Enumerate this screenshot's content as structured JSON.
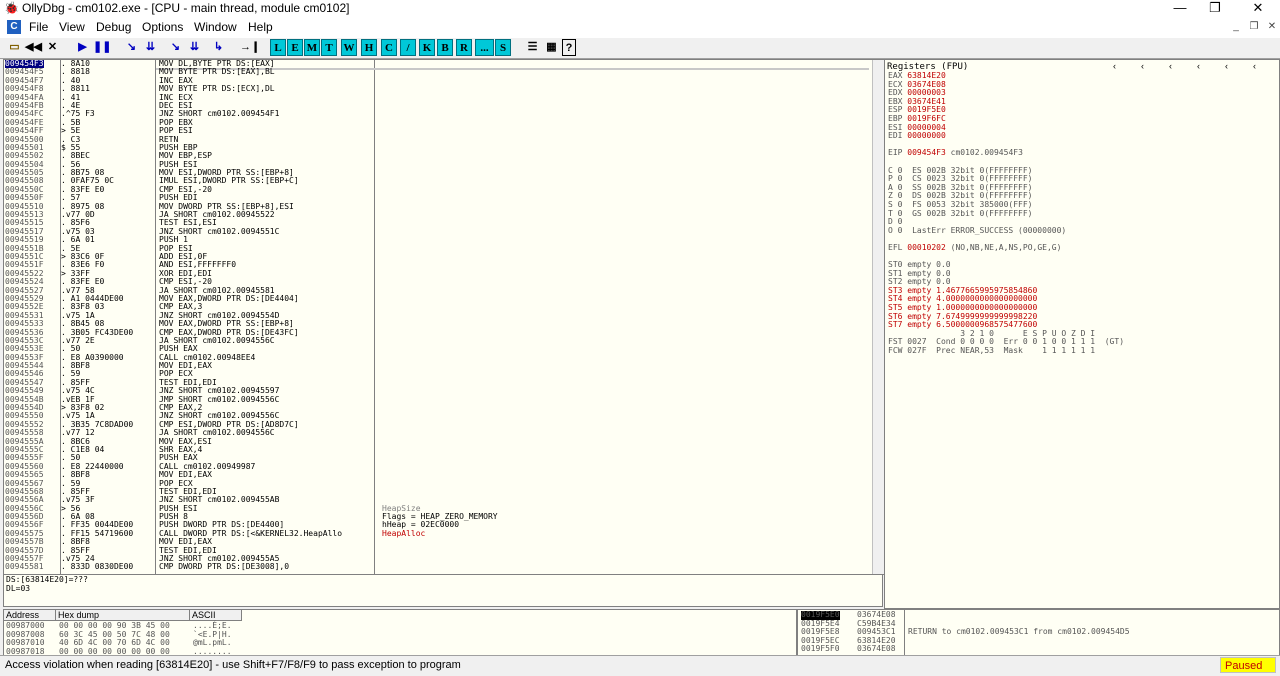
{
  "window": {
    "title": "OllyDbg - cm0102.exe - [CPU - main thread, module cm0102]",
    "minimize": "—",
    "restore": "❐",
    "close": "✕"
  },
  "menu": [
    "File",
    "View",
    "Debug",
    "Options",
    "Window",
    "Help"
  ],
  "toolbar": {
    "icon_buttons": [
      "open-icon",
      "rewind-icon",
      "close-icon",
      "run-icon",
      "pause-icon",
      "step-into-icon",
      "step-over-icon",
      "trace-into-icon",
      "trace-over-icon",
      "execute-till-return-icon",
      "goto-icon"
    ],
    "window_buttons": [
      "L",
      "E",
      "M",
      "T",
      "W",
      "H",
      "C",
      "/",
      "K",
      "B",
      "R",
      "...",
      "S"
    ],
    "extra": [
      "list-icon",
      "grid-icon",
      "help-icon"
    ]
  },
  "disasm": [
    {
      "addr": "009454F3",
      "hex": ". 8A10",
      "cmd": "MOV DL,BYTE PTR DS:[EAX]",
      "sel": true
    },
    {
      "addr": "009454F5",
      "hex": ". 8818",
      "cmd": "MOV BYTE PTR DS:[EAX],BL"
    },
    {
      "addr": "009454F7",
      "hex": ". 40",
      "cmd": "INC EAX"
    },
    {
      "addr": "009454F8",
      "hex": ". 8811",
      "cmd": "MOV BYTE PTR DS:[ECX],DL"
    },
    {
      "addr": "009454FA",
      "hex": ". 41",
      "cmd": "INC ECX"
    },
    {
      "addr": "009454FB",
      "hex": ". 4E",
      "cmd": "DEC ESI"
    },
    {
      "addr": "009454FC",
      "hex": ".^75 F3",
      "cmd": "JNZ SHORT cm0102.009454F1"
    },
    {
      "addr": "009454FE",
      "hex": ". 5B",
      "cmd": "POP EBX"
    },
    {
      "addr": "009454FF",
      "hex": "> 5E",
      "cmd": "POP ESI"
    },
    {
      "addr": "00945500",
      "hex": ". C3",
      "cmd": "RETN"
    },
    {
      "addr": "00945501",
      "hex": "$ 55",
      "cmd": "PUSH EBP"
    },
    {
      "addr": "00945502",
      "hex": ". 8BEC",
      "cmd": "MOV EBP,ESP"
    },
    {
      "addr": "00945504",
      "hex": ". 56",
      "cmd": "PUSH ESI"
    },
    {
      "addr": "00945505",
      "hex": ". 8B75 08",
      "cmd": "MOV ESI,DWORD PTR SS:[EBP+8]"
    },
    {
      "addr": "00945508",
      "hex": ". 0FAF75 0C",
      "cmd": "IMUL ESI,DWORD PTR SS:[EBP+C]"
    },
    {
      "addr": "0094550C",
      "hex": ". 83FE E0",
      "cmd": "CMP ESI,-20"
    },
    {
      "addr": "0094550F",
      "hex": ". 57",
      "cmd": "PUSH EDI"
    },
    {
      "addr": "00945510",
      "hex": ". 8975 08",
      "cmd": "MOV DWORD PTR SS:[EBP+8],ESI"
    },
    {
      "addr": "00945513",
      "hex": ".v77 0D",
      "cmd": "JA SHORT cm0102.00945522"
    },
    {
      "addr": "00945515",
      "hex": ". 85F6",
      "cmd": "TEST ESI,ESI"
    },
    {
      "addr": "00945517",
      "hex": ".v75 03",
      "cmd": "JNZ SHORT cm0102.0094551C"
    },
    {
      "addr": "00945519",
      "hex": ". 6A 01",
      "cmd": "PUSH 1"
    },
    {
      "addr": "0094551B",
      "hex": ". 5E",
      "cmd": "POP ESI"
    },
    {
      "addr": "0094551C",
      "hex": "> 83C6 0F",
      "cmd": "ADD ESI,0F"
    },
    {
      "addr": "0094551F",
      "hex": ". 83E6 F0",
      "cmd": "AND ESI,FFFFFFF0"
    },
    {
      "addr": "00945522",
      "hex": "> 33FF",
      "cmd": "XOR EDI,EDI"
    },
    {
      "addr": "00945524",
      "hex": ". 83FE E0",
      "cmd": "CMP ESI,-20"
    },
    {
      "addr": "00945527",
      "hex": ".v77 58",
      "cmd": "JA SHORT cm0102.00945581"
    },
    {
      "addr": "00945529",
      "hex": ". A1 0444DE00",
      "cmd": "MOV EAX,DWORD PTR DS:[DE4404]"
    },
    {
      "addr": "0094552E",
      "hex": ". 83F8 03",
      "cmd": "CMP EAX,3"
    },
    {
      "addr": "00945531",
      "hex": ".v75 1A",
      "cmd": "JNZ SHORT cm0102.0094554D"
    },
    {
      "addr": "00945533",
      "hex": ". 8B45 08",
      "cmd": "MOV EAX,DWORD PTR SS:[EBP+8]"
    },
    {
      "addr": "00945536",
      "hex": ". 3B05 FC43DE00",
      "cmd": "CMP EAX,DWORD PTR DS:[DE43FC]"
    },
    {
      "addr": "0094553C",
      "hex": ".v77 2E",
      "cmd": "JA SHORT cm0102.0094556C"
    },
    {
      "addr": "0094553E",
      "hex": ". 50",
      "cmd": "PUSH EAX"
    },
    {
      "addr": "0094553F",
      "hex": ". E8 A0390000",
      "cmd": "CALL cm0102.00948EE4"
    },
    {
      "addr": "00945544",
      "hex": ". 8BF8",
      "cmd": "MOV EDI,EAX"
    },
    {
      "addr": "00945546",
      "hex": ". 59",
      "cmd": "POP ECX"
    },
    {
      "addr": "00945547",
      "hex": ". 85FF",
      "cmd": "TEST EDI,EDI"
    },
    {
      "addr": "00945549",
      "hex": ".v75 4C",
      "cmd": "JNZ SHORT cm0102.00945597"
    },
    {
      "addr": "0094554B",
      "hex": ".vEB 1F",
      "cmd": "JMP SHORT cm0102.0094556C"
    },
    {
      "addr": "0094554D",
      "hex": "> 83F8 02",
      "cmd": "CMP EAX,2"
    },
    {
      "addr": "00945550",
      "hex": ".v75 1A",
      "cmd": "JNZ SHORT cm0102.0094556C"
    },
    {
      "addr": "00945552",
      "hex": ". 3B35 7C8DAD00",
      "cmd": "CMP ESI,DWORD PTR DS:[AD8D7C]"
    },
    {
      "addr": "00945558",
      "hex": ".v77 12",
      "cmd": "JA SHORT cm0102.0094556C"
    },
    {
      "addr": "0094555A",
      "hex": ". 8BC6",
      "cmd": "MOV EAX,ESI"
    },
    {
      "addr": "0094555C",
      "hex": ". C1E8 04",
      "cmd": "SHR EAX,4"
    },
    {
      "addr": "0094555F",
      "hex": ". 50",
      "cmd": "PUSH EAX"
    },
    {
      "addr": "00945560",
      "hex": ". E8 22440000",
      "cmd": "CALL cm0102.00949987"
    },
    {
      "addr": "00945565",
      "hex": ". 8BF8",
      "cmd": "MOV EDI,EAX"
    },
    {
      "addr": "00945567",
      "hex": ". 59",
      "cmd": "POP ECX"
    },
    {
      "addr": "00945568",
      "hex": ". 85FF",
      "cmd": "TEST EDI,EDI"
    },
    {
      "addr": "0094556A",
      "hex": ".v75 3F",
      "cmd": "JNZ SHORT cm0102.009455AB"
    },
    {
      "addr": "0094556C",
      "hex": "> 56",
      "cmd": "PUSH ESI",
      "cmt": "HeapSize",
      "cmtcolor": "#808080"
    },
    {
      "addr": "0094556D",
      "hex": ". 6A 08",
      "cmd": "PUSH 8",
      "cmt": "Flags = HEAP_ZERO_MEMORY",
      "cmtcolor": "#000"
    },
    {
      "addr": "0094556F",
      "hex": ". FF35 0044DE00",
      "cmd": "PUSH DWORD PTR DS:[DE4400]",
      "cmt": "hHeap = 02EC0000",
      "cmtcolor": "#000"
    },
    {
      "addr": "00945575",
      "hex": ". FF15 54719600",
      "cmd": "CALL DWORD PTR DS:[<&KERNEL32.HeapAllo",
      "cmt": "HeapAlloc",
      "cmtcolor": "#c00000"
    },
    {
      "addr": "0094557B",
      "hex": ". 8BF8",
      "cmd": "MOV EDI,EAX"
    },
    {
      "addr": "0094557D",
      "hex": ". 85FF",
      "cmd": "TEST EDI,EDI"
    },
    {
      "addr": "0094557F",
      "hex": ".v75 24",
      "cmd": "JNZ SHORT cm0102.009455A5"
    },
    {
      "addr": "00945581",
      "hex": ". 833D 0830DE00",
      "cmd": "CMP DWORD PTR DS:[DE3008],0"
    }
  ],
  "info": {
    "line1": "DS:[63814E20]=???",
    "line2": "DL=03"
  },
  "registers": {
    "header": "Registers (FPU)",
    "gpr": [
      {
        "name": "EAX",
        "val": "63814E20"
      },
      {
        "name": "ECX",
        "val": "03674E08"
      },
      {
        "name": "EDX",
        "val": "00000003"
      },
      {
        "name": "EBX",
        "val": "03674E41"
      },
      {
        "name": "ESP",
        "val": "0019F5E0"
      },
      {
        "name": "EBP",
        "val": "0019F6FC"
      },
      {
        "name": "ESI",
        "val": "00000004"
      },
      {
        "name": "EDI",
        "val": "00000000"
      }
    ],
    "eip": {
      "name": "EIP",
      "val": "009454F3",
      "desc": "cm0102.009454F3"
    },
    "flags": [
      "C 0  ES 002B 32bit 0(FFFFFFFF)",
      "P 0  CS 0023 32bit 0(FFFFFFFF)",
      "A 0  SS 002B 32bit 0(FFFFFFFF)",
      "Z 0  DS 002B 32bit 0(FFFFFFFF)",
      "S 0  FS 0053 32bit 385000(FFF)",
      "T 0  GS 002B 32bit 0(FFFFFFFF)",
      "D 0",
      "O 0  LastErr ERROR_SUCCESS (00000000)"
    ],
    "efl": {
      "name": "EFL",
      "val": "00010202",
      "desc": "(NO,NB,NE,A,NS,PO,GE,G)"
    },
    "fpu": [
      "ST0 empty 0.0",
      "ST1 empty 0.0",
      "ST2 empty 0.0",
      "ST3 empty 1.4677665995975854860",
      "ST4 empty 4.0000000000000000000",
      "ST5 empty 1.0000000000000000000",
      "ST6 empty 7.6749999999999998220",
      "ST7 empty 6.5000000968575477600"
    ],
    "fpu_hdr": "               3 2 1 0      E S P U O Z D I",
    "fst": "FST 0027  Cond 0 0 0 0  Err 0 0 1 0 0 1 1 1  (GT)",
    "fcw": "FCW 027F  Prec NEAR,53  Mask    1 1 1 1 1 1"
  },
  "dump": {
    "headers": [
      "Address",
      "Hex dump",
      "ASCII"
    ],
    "rows": [
      {
        "addr": "00987000",
        "hex": "00 00 00 00 90 3B 45 00",
        "ascii": "....É;E."
      },
      {
        "addr": "00987008",
        "hex": "60 3C 45 00 50 7C 48 00",
        "ascii": "`<E.P|H."
      },
      {
        "addr": "00987010",
        "hex": "40 6D 4C 00 70 6D 4C 00",
        "ascii": "@mL.pmL."
      },
      {
        "addr": "00987018",
        "hex": "00 00 00 00 00 00 00 00",
        "ascii": "........"
      }
    ]
  },
  "stack": [
    {
      "addr": "0019F5E0",
      "val": "03674E08",
      "cmt": "",
      "sel": true
    },
    {
      "addr": "0019F5E4",
      "val": "C59B4E34",
      "cmt": ""
    },
    {
      "addr": "0019F5E8",
      "val": "009453C1",
      "cmt": "RETURN to cm0102.009453C1 from cm0102.009454D5"
    },
    {
      "addr": "0019F5EC",
      "val": "63814E20",
      "cmt": ""
    },
    {
      "addr": "0019F5F0",
      "val": "03674E08",
      "cmt": ""
    }
  ],
  "status": {
    "message": "Access violation when reading [63814E20] - use Shift+F7/F8/F9 to pass exception to program",
    "state": "Paused"
  }
}
